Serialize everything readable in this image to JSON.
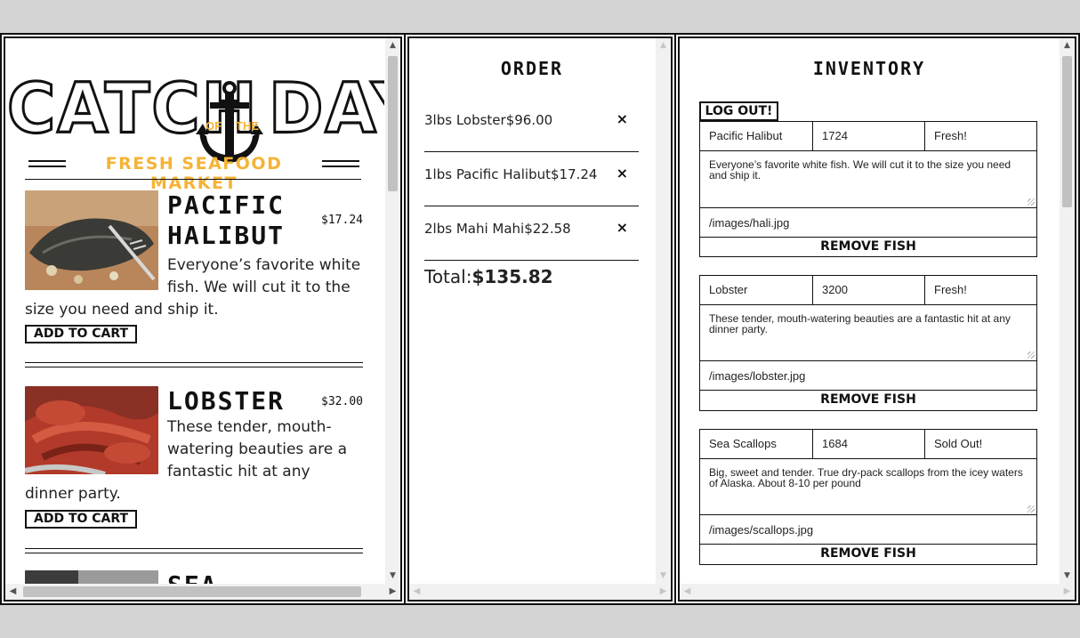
{
  "menu": {
    "logo": {
      "word1": "CATCH",
      "of": "OF",
      "the": "THE",
      "word2": "DAY",
      "tagline": "FRESH SEAFOOD MARKET"
    },
    "items": [
      {
        "name_line1": "PACIFIC",
        "name_line2": "HALIBUT",
        "price": "$17.24",
        "desc": "Everyone’s favorite white fish. We will cut it to the size you need and ship it.",
        "button": "ADD TO CART"
      },
      {
        "name_line1": "LOBSTER",
        "price": "$32.00",
        "desc": "These tender, mouth-watering beauties are a fantastic hit at any dinner party.",
        "button": "ADD TO CART"
      },
      {
        "name_line1": "SEA"
      }
    ]
  },
  "order": {
    "title": "ORDER",
    "rows": [
      {
        "text": "3lbs Lobster$96.00",
        "remove": "×"
      },
      {
        "text": "1lbs Pacific Halibut$17.24",
        "remove": "×"
      },
      {
        "text": "2lbs Mahi Mahi$22.58",
        "remove": "×"
      }
    ],
    "total_label": "Total:",
    "total_value": "$135.82"
  },
  "inventory": {
    "title": "INVENTORY",
    "logout": "LOG OUT!",
    "fish": [
      {
        "name": "Pacific Halibut",
        "price": "1724",
        "status": "Fresh!",
        "desc": "Everyone’s favorite white fish. We will cut it to the size you need and ship it.",
        "image": "/images/hali.jpg",
        "remove": "REMOVE FISH"
      },
      {
        "name": "Lobster",
        "price": "3200",
        "status": "Fresh!",
        "desc": "These tender, mouth-watering beauties are a fantastic hit at any dinner party.",
        "image": "/images/lobster.jpg",
        "remove": "REMOVE FISH"
      },
      {
        "name": "Sea Scallops",
        "price": "1684",
        "status": "Sold Out!",
        "desc": "Big, sweet and tender. True dry-pack scallops from the icey waters of Alaska. About 8-10 per pound",
        "image": "/images/scallops.jpg",
        "remove": "REMOVE FISH"
      }
    ]
  },
  "colors": {
    "accent": "#f5b335",
    "ink": "#111111",
    "panel_bg": "#ffffff",
    "page_bg": "#d4d4d4"
  }
}
